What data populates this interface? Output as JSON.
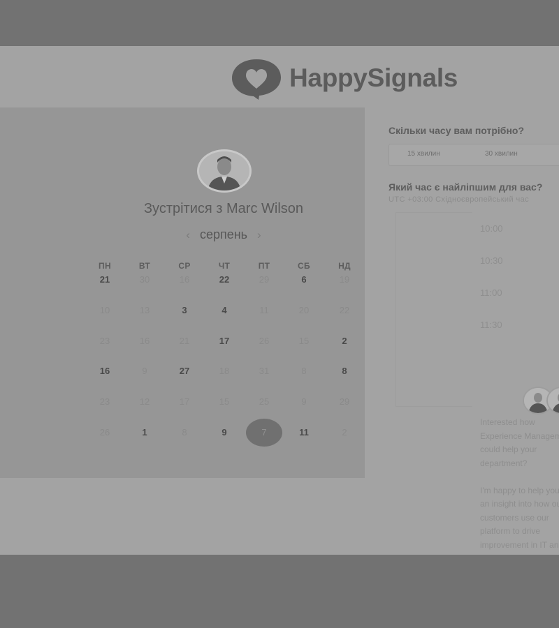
{
  "header": {
    "brand": "HappySignals",
    "logo_icon": "heart-speech-bubble-icon"
  },
  "scheduler": {
    "title": "Зустрітися з Marc Wilson",
    "month": "серпень",
    "prev_icon": "chevron-left-icon",
    "next_icon": "chevron-right-icon",
    "weekdays": [
      "ПН",
      "ВТ",
      "СР",
      "ЧТ",
      "ПТ",
      "СБ",
      "НД"
    ],
    "weeks": [
      [
        "21",
        "30",
        "16",
        "22",
        "29",
        "6",
        "19"
      ],
      [
        "10",
        "13",
        "3",
        "4",
        "11",
        "20",
        "22"
      ],
      [
        "23",
        "16",
        "21",
        "17",
        "26",
        "15",
        "2"
      ],
      [
        "16",
        "9",
        "27",
        "18",
        "31",
        "8",
        "8"
      ],
      [
        "23",
        "12",
        "17",
        "15",
        "25",
        "9",
        "29"
      ],
      [
        "26",
        "1",
        "8",
        "9",
        "7",
        "11",
        "2"
      ]
    ],
    "available": [
      [
        true,
        false,
        false,
        true,
        false,
        true,
        false
      ],
      [
        false,
        false,
        true,
        true,
        false,
        false,
        false
      ],
      [
        false,
        false,
        false,
        true,
        false,
        false,
        true
      ],
      [
        true,
        false,
        true,
        false,
        false,
        false,
        true
      ],
      [
        false,
        false,
        false,
        false,
        false,
        false,
        false
      ],
      [
        false,
        true,
        false,
        true,
        false,
        true,
        false
      ]
    ],
    "selected": {
      "week": 5,
      "day": 4
    }
  },
  "booking": {
    "duration_question": "Скільки часу вам потрібно?",
    "durations": [
      "15 хвилин",
      "30 хвилин"
    ],
    "time_question": "Який час є найліпшим для вас?",
    "timezone": "UTC +03:00 Східноєвропейський час",
    "slots": [
      "10:00",
      "10:30",
      "11:00",
      "11:30"
    ]
  },
  "host": {
    "blurb": [
      "Interested how Experience Management could help your department?",
      "I'm happy to help you get an insight into how our customers use our platform to drive improvement in IT and productivity."
    ]
  },
  "colors": {
    "backdrop": "#737373",
    "page": "#a3a3a3",
    "calendar_panel": "#969696",
    "selected_day": "#707070"
  }
}
